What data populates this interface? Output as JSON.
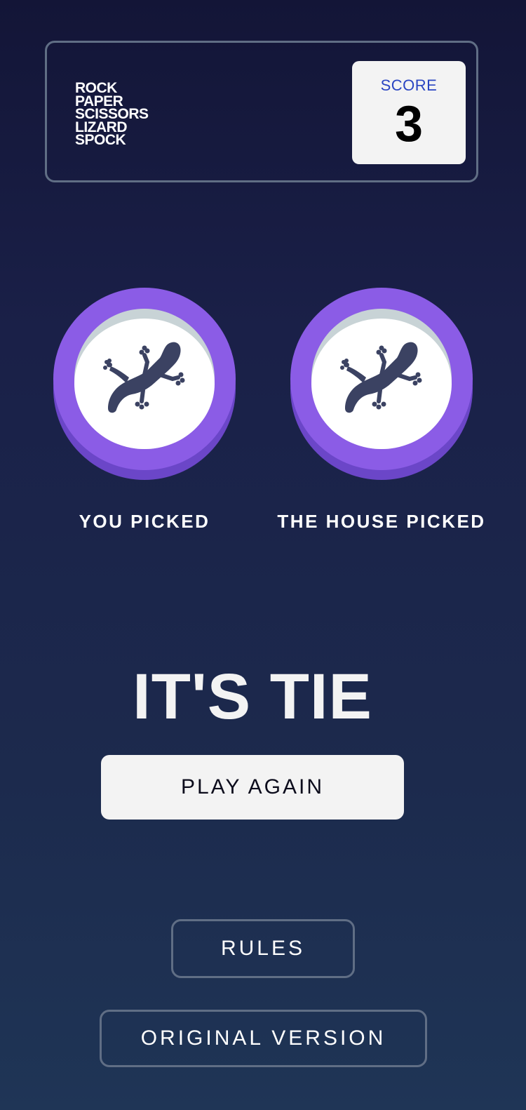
{
  "header": {
    "title_lines": [
      "ROCK",
      "PAPER",
      "SCISSORS",
      "LIZARD",
      "SPOCK"
    ],
    "score_label": "SCORE",
    "score_value": "3"
  },
  "picks": {
    "you": {
      "label": "YOU PICKED",
      "choice_icon": "lizard-icon",
      "ring_color": "#8b5ce6"
    },
    "house": {
      "label": "THE HOUSE PICKED",
      "choice_icon": "lizard-icon",
      "ring_color": "#8b5ce6"
    }
  },
  "result": {
    "text": "IT'S TIE",
    "play_again_label": "PLAY AGAIN"
  },
  "footer": {
    "rules_label": "RULES",
    "original_version_label": "ORIGINAL VERSION"
  },
  "colors": {
    "accent_blue": "#2a45c2",
    "lizard_ring": "#8b5ce6",
    "icon_dark": "#3b4262"
  }
}
